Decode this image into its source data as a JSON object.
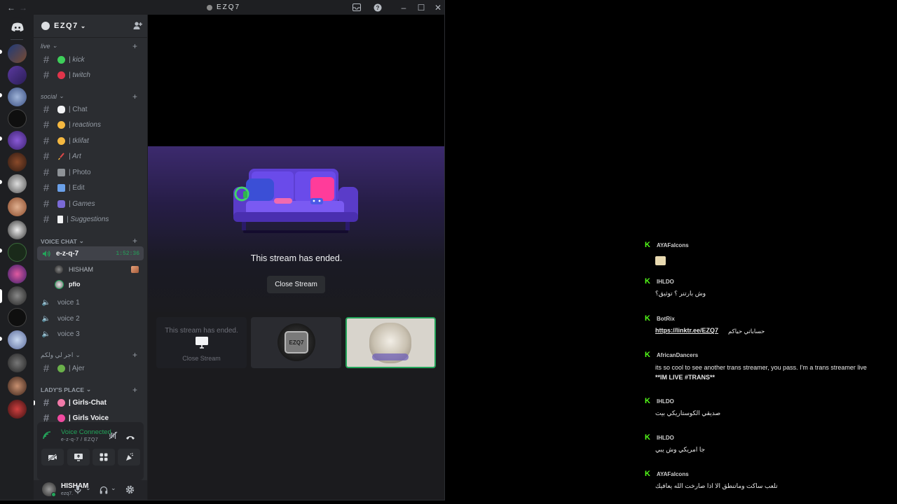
{
  "window": {
    "title": "EZQ7"
  },
  "server": {
    "name": "EZQ7"
  },
  "categories": {
    "live": "live",
    "social": "social",
    "voice_chat": "VOICE CHAT",
    "arabic": "اجر لي ولكم",
    "ladys_place": "LADY'S PLACE"
  },
  "channels": {
    "kick": "| kick",
    "twitch": "| twitch",
    "chat": "| Chat",
    "reactions": "| reactions",
    "tklifat": "| tklifat",
    "art": "| Art",
    "photo": "| Photo",
    "edit": "| Edit",
    "games": "| Games",
    "suggestions": "| Suggestions",
    "ajer": "| Ajer",
    "girls_chat": "| Girls-Chat",
    "girls_voice": "| Girls Voice"
  },
  "voice": {
    "active_channel": "e-z-q-7",
    "timer": "1:52:36",
    "members": [
      "HISHAM",
      "pfio"
    ],
    "others": [
      "voice 1",
      "voice 2",
      "voice 3"
    ]
  },
  "voice_panel": {
    "status": "Voice Connected",
    "location": "e-z-q-7 / EZQ7"
  },
  "user": {
    "name": "HISHAM",
    "tag": "ezq7."
  },
  "stream": {
    "ended_message": "This stream has ended.",
    "close_button": "Close Stream",
    "thumb_ended": "This stream has ended.",
    "thumb_close": "Close Stream",
    "thumb_badge": "EZQ7"
  },
  "chat": {
    "messages": [
      {
        "name": "AYAFalcons",
        "text": ""
      },
      {
        "name": "IHLDO",
        "text": "وش بارتنر ؟ توثيق؟"
      },
      {
        "name": "BotRix",
        "link": "https://linktr.ee/EZQ7",
        "text": "حساباتي حياكم"
      },
      {
        "name": "AfricanDancers",
        "text": "its so cool to see another trans streamer, you pass. I'm a trans streamer live",
        "text2": "**IM LIVE #TRANS**"
      },
      {
        "name": "IHLDO",
        "text": "صديقي الكوستاريكي بيت"
      },
      {
        "name": "IHLDO",
        "text": "جا امريكي وش يبي"
      },
      {
        "name": "AYAFalcons",
        "text": "تلعب ساكت وماتنطق الا اذا صارخت الله يعافيك"
      }
    ]
  },
  "colors": {
    "discord_bg": "#1e1f22",
    "sidebar": "#2b2d31",
    "voice_green": "#23a55a",
    "kick_green": "#53fc18",
    "accent_purple": "#5865f2"
  }
}
